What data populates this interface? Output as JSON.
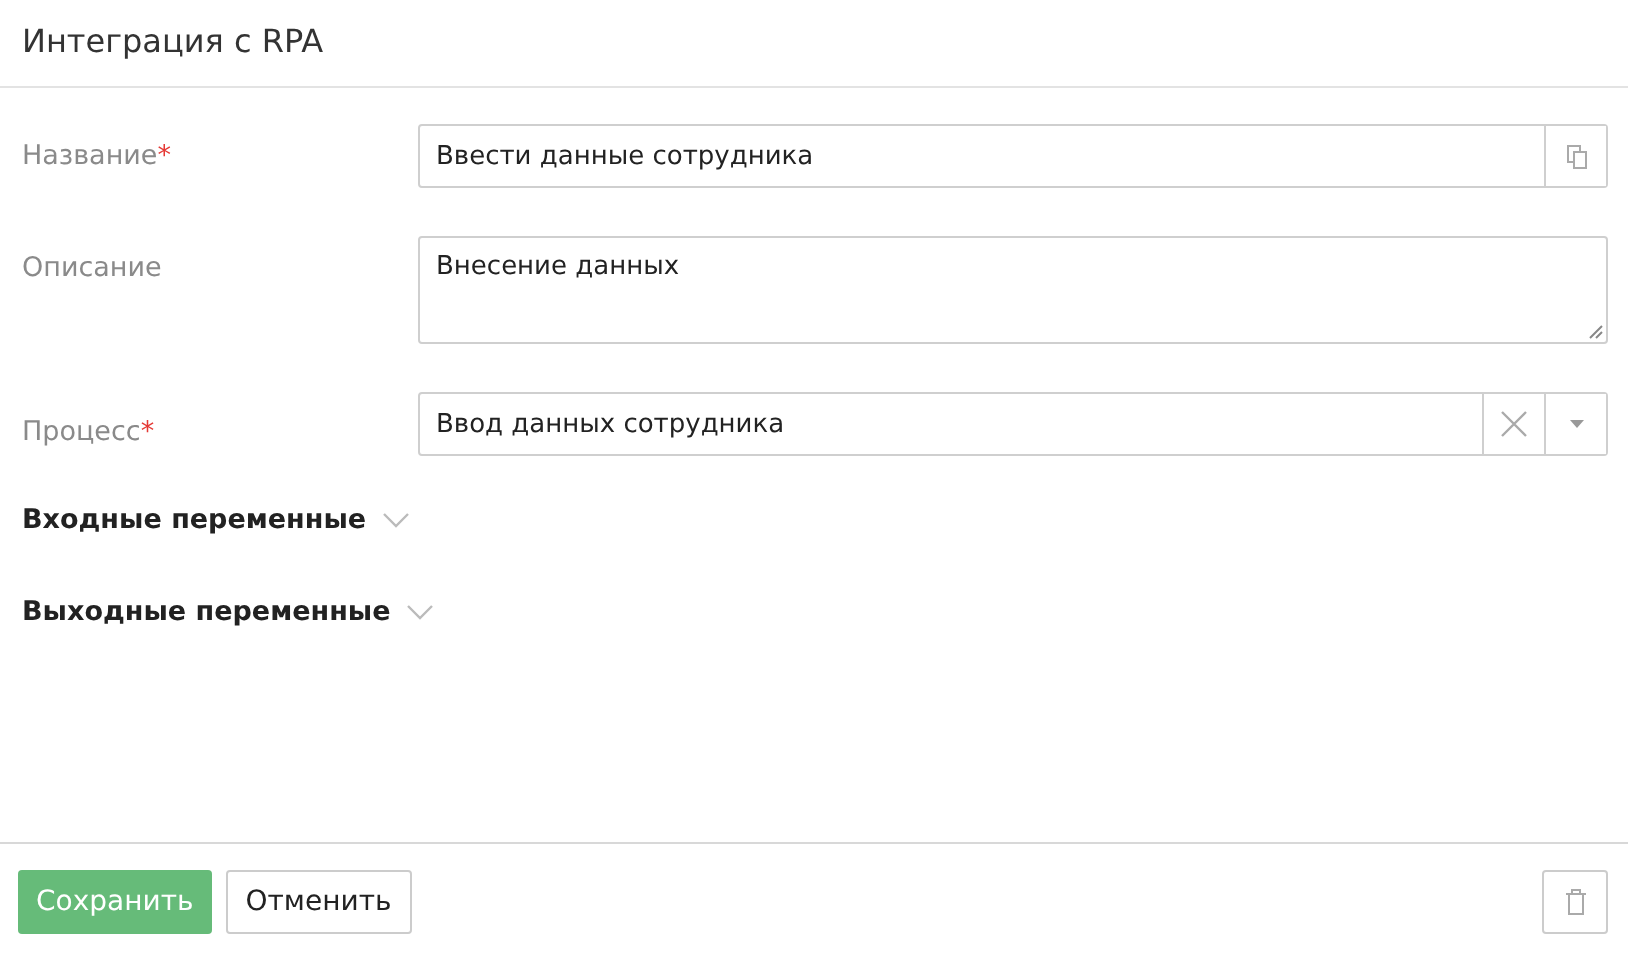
{
  "window": {
    "title": "Интеграция с RPA"
  },
  "fields": [
    {
      "kind": "text",
      "label": "Название",
      "required_mark": "*",
      "value": "Ввести данные сотрудника"
    },
    {
      "kind": "textarea",
      "label": "Описание",
      "value": "Внесение данных"
    },
    {
      "kind": "select",
      "label": "Процесс",
      "required_mark": "*",
      "value": "Ввод данных сотрудника"
    }
  ],
  "sections": [
    {
      "title": "Входные переменные",
      "expanded": false
    },
    {
      "title": "Выходные переменные",
      "expanded": false
    }
  ],
  "buttons": [
    {
      "label": "Сохранить",
      "kind": "primary"
    },
    {
      "label": "Отменить",
      "kind": "secondary"
    }
  ]
}
